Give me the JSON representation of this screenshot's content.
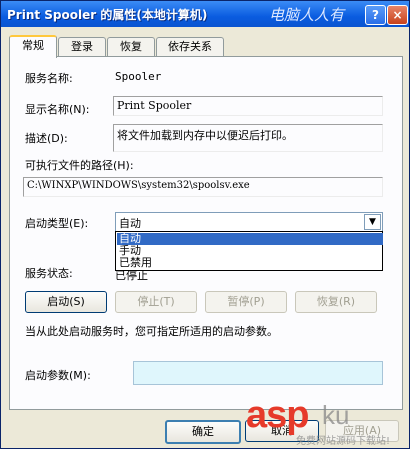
{
  "window": {
    "title": "Print Spooler 的属性(本地计算机)",
    "watermark_top": "电脑人人有",
    "help_label": "?",
    "close_label": "×"
  },
  "tabs": [
    {
      "label": "常规",
      "active": true
    },
    {
      "label": "登录",
      "active": false
    },
    {
      "label": "恢复",
      "active": false
    },
    {
      "label": "依存关系",
      "active": false
    }
  ],
  "general": {
    "service_name_label": "服务名称:",
    "service_name_value": "Spooler",
    "display_name_label": "显示名称(N):",
    "display_name_value": "Print Spooler",
    "description_label": "描述(D):",
    "description_value": "将文件加载到内存中以便迟后打印。",
    "path_label": "可执行文件的路径(H):",
    "path_value": "C:\\WINXP\\WINDOWS\\system32\\spoolsv.exe",
    "startup_type_label": "启动类型(E):",
    "startup_type_value": "自动",
    "startup_options": [
      "自动",
      "手动",
      "已禁用"
    ],
    "startup_selected_index": 0,
    "status_label": "服务状态:",
    "status_value": "已停止",
    "buttons": {
      "start": "启动(S)",
      "stop": "停止(T)",
      "pause": "暂停(P)",
      "resume": "恢复(R)"
    },
    "hint": "当从此处启动服务时，您可指定所适用的启动参数。",
    "params_label": "启动参数(M):",
    "params_value": ""
  },
  "footer": {
    "ok": "确定",
    "cancel": "取消",
    "apply": "应用(A)"
  },
  "watermark": {
    "asp": "asp",
    "ku": "ku",
    "sub": "免费网站源码下载站!"
  }
}
